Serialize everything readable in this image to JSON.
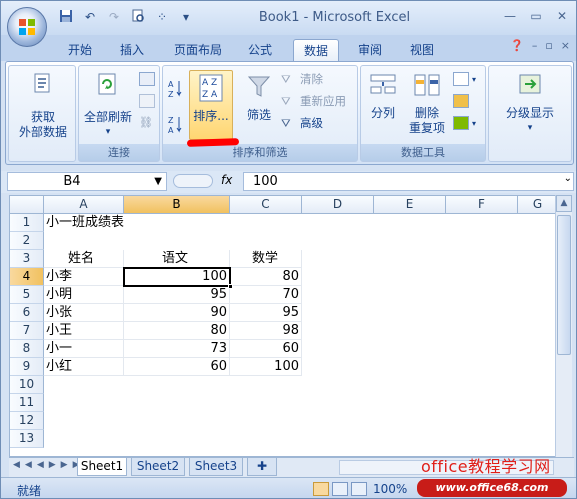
{
  "window": {
    "title": "Book1 - Microsoft Excel"
  },
  "qat": {
    "save": "save-icon",
    "undo": "undo-icon",
    "redo": "redo-icon",
    "preview": "print-preview-icon",
    "more": "customize-icon",
    "dropdown": "▾"
  },
  "tabs": [
    {
      "label": "开始"
    },
    {
      "label": "插入"
    },
    {
      "label": "页面布局"
    },
    {
      "label": "公式"
    },
    {
      "label": "数据",
      "active": true
    },
    {
      "label": "审阅"
    },
    {
      "label": "视图"
    }
  ],
  "ribbon": {
    "get_external": {
      "label1": "获取",
      "label2": "外部数据"
    },
    "connections": {
      "group": "连接",
      "refresh_all": "全部刷新"
    },
    "sort_filter": {
      "group": "排序和筛选",
      "sort": "排序...",
      "filter": "筛选",
      "clear": "清除",
      "reapply": "重新应用",
      "advanced": "高级"
    },
    "data_tools": {
      "group": "数据工具",
      "split": "分列",
      "remove_dup1": "删除",
      "remove_dup2": "重复项"
    },
    "outline": {
      "label": "分级显示"
    }
  },
  "formula_bar": {
    "name_box": "B4",
    "fx": "fx",
    "value": "100"
  },
  "columns": [
    "A",
    "B",
    "C",
    "D",
    "E",
    "F",
    "G"
  ],
  "rows": [
    "1",
    "2",
    "3",
    "4",
    "5",
    "6",
    "7",
    "8",
    "9",
    "10",
    "11",
    "12",
    "13"
  ],
  "cells": {
    "a1": "小一班成绩表",
    "a3": "姓名",
    "b3": "语文",
    "c3": "数学",
    "a4": "小李",
    "b4": "100",
    "c4": "80",
    "a5": "小明",
    "b5": "95",
    "c5": "70",
    "a6": "小张",
    "b6": "90",
    "c6": "95",
    "a7": "小王",
    "b7": "80",
    "c7": "98",
    "a8": "小一",
    "b8": "73",
    "c8": "60",
    "a9": "小红",
    "b9": "60",
    "c9": "100"
  },
  "sheets": [
    "Sheet1",
    "Sheet2",
    "Sheet3"
  ],
  "status": {
    "text": "就绪",
    "zoom": "100%"
  },
  "watermark": {
    "line1": "office教程学习网",
    "line2": "www.office68.com"
  },
  "colors": {
    "accent": "#15428b",
    "selected_header": "#f1c15f",
    "ribbon": "#dbe7f6"
  }
}
